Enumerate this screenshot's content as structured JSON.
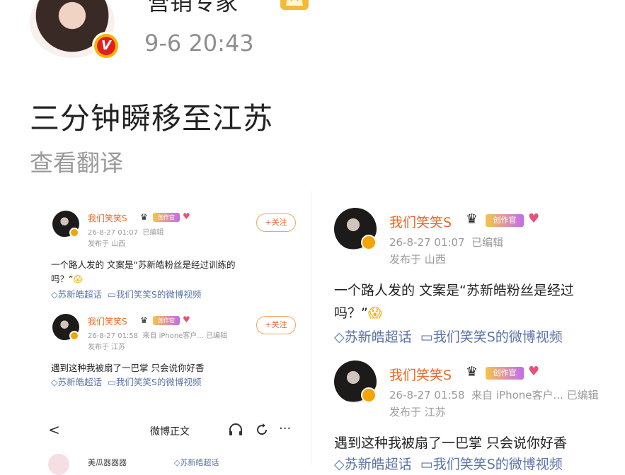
{
  "header": {
    "username": "营销专家",
    "time": "9-6 20:43",
    "verified_badge": "V",
    "crown_icon": "crown-icon"
  },
  "post": {
    "text": "三分钟瞬移至江苏",
    "translate_label": "查看翻译"
  },
  "embedded_left": {
    "card1": {
      "username": "我们笑笑S",
      "tag": "创作官",
      "follow_label": "+关注",
      "timestamp": "26-8-27 01:07",
      "edited": "已编辑",
      "location": "发布于 山西",
      "text_line1": "一个路人发的 文案是“苏新皓粉丝是经过训练的",
      "text_line2": "吗？”",
      "topic1": "苏新皓超话",
      "topic2": "我们笑笑S的微博视频"
    },
    "card2": {
      "username": "我们笑笑S",
      "tag": "创作官",
      "follow_label": "+关注",
      "timestamp": "26-8-27 01:58",
      "source": "来自 iPhone客户...",
      "edited": "已编辑",
      "location": "发布于 江苏",
      "text": "遇到这种我被扇了一巴掌 只会说你好香",
      "topic1": "苏新皓超话",
      "topic2": "我们笑笑S的微博视频"
    },
    "nav": {
      "back": "<",
      "title": "微博正文",
      "listen_icon": "listen-icon",
      "refresh_icon": "refresh-icon",
      "more": "···"
    },
    "bottom": {
      "username": "美瓜器器器",
      "topic": "苏新皓超话"
    }
  },
  "embedded_right": {
    "card1": {
      "username": "我们笑笑S",
      "tag": "创作官",
      "timestamp": "26-8-27 01:07",
      "edited": "已编辑",
      "location": "发布于 山西",
      "text_line1": "一个路人发的 文案是“苏新皓粉丝是经过",
      "text_line2": "吗？”",
      "topic1": "苏新皓超话",
      "topic2": "我们笑笑S的微博视频"
    },
    "card2": {
      "username": "我们笑笑S",
      "tag": "创作官",
      "timestamp": "26-8-27 01:58",
      "source": "来自 iPhone客户...",
      "edited": "已编辑",
      "location": "发布于 江苏",
      "text": "遇到这种我被扇了一巴掌 只会说你好香",
      "topic1": "苏新皓超话",
      "topic2": "我们笑笑S的微博视频"
    }
  },
  "colors": {
    "username_orange": "#e8682a",
    "topic_blue": "#5b74a8",
    "meta_gray": "#9a9a9a"
  }
}
